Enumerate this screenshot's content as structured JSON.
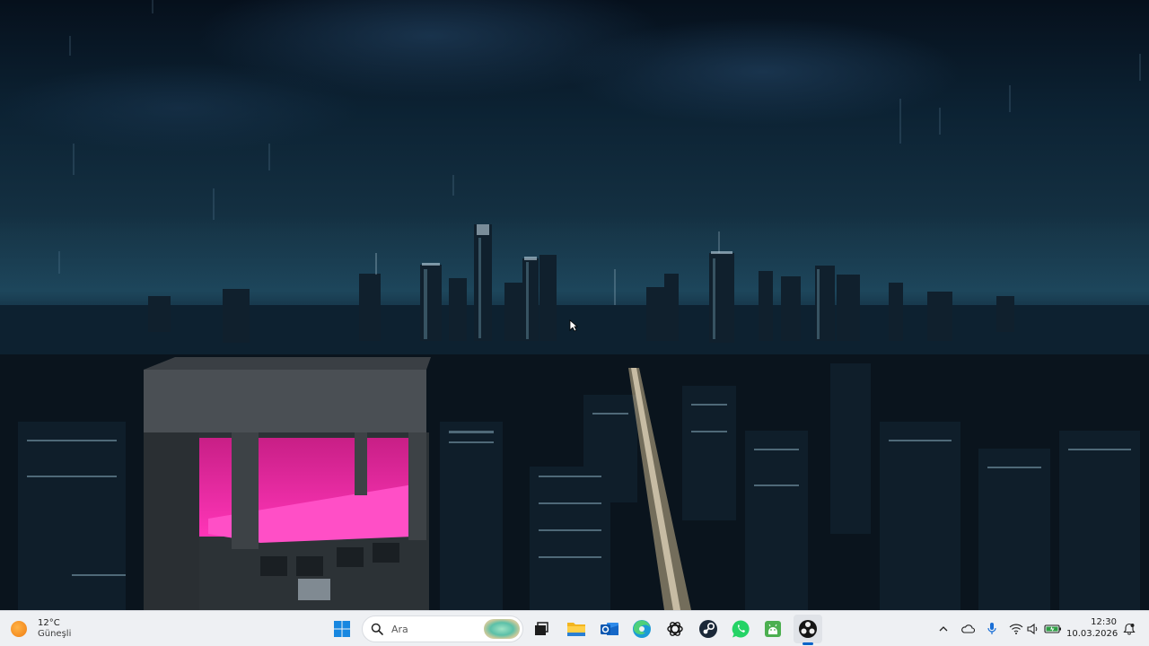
{
  "taskbar": {
    "weather": {
      "temperature": "12°C",
      "condition": "Güneşli",
      "icon": "sun-icon"
    },
    "search": {
      "placeholder": "Ara"
    },
    "apps": [
      {
        "name": "task-view",
        "icon": "task-view-icon"
      },
      {
        "name": "file-explorer",
        "icon": "folder-icon"
      },
      {
        "name": "outlook",
        "icon": "outlook-icon"
      },
      {
        "name": "edge",
        "icon": "edge-icon"
      },
      {
        "name": "chatgpt",
        "icon": "chatgpt-icon"
      },
      {
        "name": "steam",
        "icon": "steam-icon"
      },
      {
        "name": "whatsapp",
        "icon": "whatsapp-icon"
      },
      {
        "name": "android-app",
        "icon": "android-icon"
      },
      {
        "name": "obs-studio",
        "icon": "obs-icon",
        "active": true
      }
    ],
    "tray": {
      "icons": [
        "chevron-up-icon",
        "cloud-icon",
        "microphone-icon",
        "wifi-icon",
        "speaker-icon",
        "battery-icon"
      ]
    },
    "clock": {
      "time": "12:30",
      "date": "10.03.2026"
    },
    "accent": "#0a64c8"
  }
}
